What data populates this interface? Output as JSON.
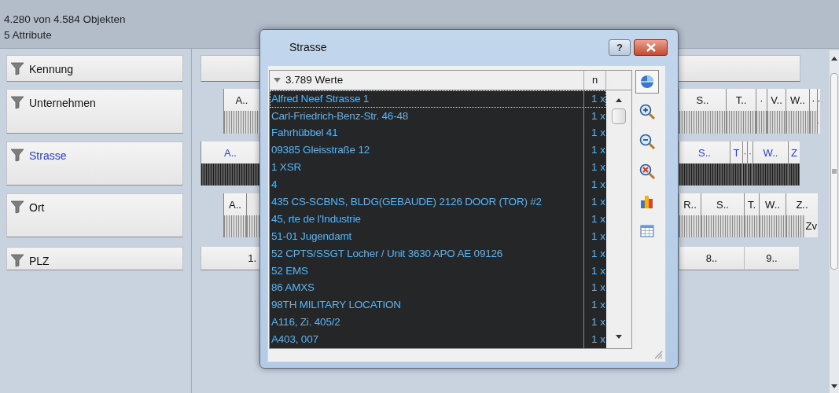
{
  "header": {
    "objects": "4.280 von 4.584 Objekten",
    "attributes": "5 Attribute"
  },
  "attributes": [
    {
      "label": "Kennung",
      "selected": false,
      "kind": "plain"
    },
    {
      "label": "Unternehmen",
      "selected": false,
      "kind": "bins",
      "left_bins": [
        {
          "label": "A.."
        }
      ],
      "right_bins": [
        {
          "label": "S.."
        },
        {
          "label": "T.."
        },
        {
          "label": "·"
        },
        {
          "label": "V.."
        },
        {
          "label": "W.."
        },
        {
          "label": "·"
        },
        {
          "label": "·",
          "sublabel": "·"
        }
      ]
    },
    {
      "label": "Strasse",
      "selected": true,
      "kind": "bins",
      "left_bins": [
        {
          "label": "A.."
        }
      ],
      "right_bins": [
        {
          "label": "S.."
        },
        {
          "label": "T"
        },
        {
          "label": "·"
        },
        {
          "label": "·"
        },
        {
          "label": "W.."
        },
        {
          "label": "Z"
        }
      ]
    },
    {
      "label": "Ort",
      "selected": false,
      "kind": "bins",
      "left_bins": [
        {
          "label": "A.."
        },
        {
          "kind": "blank"
        }
      ],
      "right_bins": [
        {
          "label": "R.."
        },
        {
          "label": "S.."
        },
        {
          "label": "T."
        },
        {
          "label": "W.."
        },
        {
          "label": "Z..",
          "sublabel": "Zv"
        }
      ]
    },
    {
      "label": "PLZ",
      "selected": false,
      "kind": "buttons",
      "left_bins": [
        {
          "label": "1."
        }
      ],
      "right_bins": [
        {
          "label": "8.."
        },
        {
          "label": "9.."
        }
      ]
    }
  ],
  "dialog": {
    "title": "Strasse",
    "help": "?",
    "header": "3.789 Werte",
    "count_header": "n",
    "rows": [
      {
        "value": "Alfred Neef Strasse 1",
        "count": "1 x",
        "focused": true
      },
      {
        "value": "Carl-Friedrich-Benz-Str. 46-48",
        "count": "1 x",
        "focused": false
      },
      {
        "value": "Fahrhübbel 41",
        "count": "1 x",
        "focused": false
      },
      {
        "value": "09385 Gleisstraße 12",
        "count": "1 x",
        "focused": false
      },
      {
        "value": "1 XSR",
        "count": "1 x",
        "focused": false
      },
      {
        "value": "4",
        "count": "1 x",
        "focused": false
      },
      {
        "value": "435 CS-SCBNS, BLDG(GEBAUDE) 2126 DOOR (TOR) #2",
        "count": "1 x",
        "focused": false
      },
      {
        "value": "45, rte de l'Industrie",
        "count": "1 x",
        "focused": false
      },
      {
        "value": "51-01 Jugendamt",
        "count": "1 x",
        "focused": false
      },
      {
        "value": "52 CPTS/SSGT Locher / Unit 3630 APO AE 09126",
        "count": "1 x",
        "focused": false
      },
      {
        "value": "52 EMS",
        "count": "1 x",
        "focused": false
      },
      {
        "value": "86 AMXS",
        "count": "1 x",
        "focused": false
      },
      {
        "value": "98TH MILITARY LOCATION",
        "count": "1 x",
        "focused": false
      },
      {
        "value": "A116, Zi. 405/2",
        "count": "1 x",
        "focused": false
      },
      {
        "value": "A403, 007",
        "count": "1 x",
        "focused": false
      }
    ],
    "tools": [
      {
        "kind": "pie",
        "selected": true
      },
      {
        "kind": "zoom-in",
        "selected": false
      },
      {
        "kind": "zoom-out",
        "selected": false
      },
      {
        "kind": "zoom-reset",
        "selected": false
      },
      {
        "kind": "bar-chart",
        "selected": false
      },
      {
        "kind": "table",
        "selected": false
      }
    ]
  }
}
